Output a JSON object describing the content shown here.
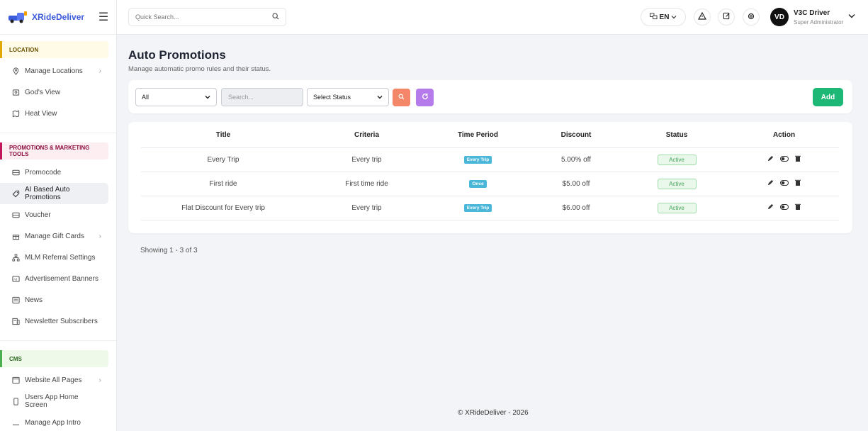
{
  "brand": {
    "name": "XRideDeliver"
  },
  "sidebar": {
    "sections": [
      {
        "title": "LOCATION",
        "items": [
          {
            "label": "Manage Locations",
            "icon": "location-pin-icon",
            "has_chevron": true
          },
          {
            "label": "God's View",
            "icon": "map-icon",
            "has_chevron": false
          },
          {
            "label": "Heat View",
            "icon": "heat-map-icon",
            "has_chevron": false
          }
        ]
      },
      {
        "title": "PROMOTIONS & MARKETING TOOLS",
        "items": [
          {
            "label": "Promocode",
            "icon": "ticket-icon",
            "has_chevron": false
          },
          {
            "label": "AI Based Auto Promotions",
            "icon": "tag-icon",
            "has_chevron": false,
            "active": true
          },
          {
            "label": "Voucher",
            "icon": "ticket-icon",
            "has_chevron": false
          },
          {
            "label": "Manage Gift Cards",
            "icon": "gift-icon",
            "has_chevron": true
          },
          {
            "label": "MLM Referral Settings",
            "icon": "hierarchy-icon",
            "has_chevron": false
          },
          {
            "label": "Advertisement Banners",
            "icon": "ad-icon",
            "has_chevron": false
          },
          {
            "label": "News",
            "icon": "news-icon",
            "has_chevron": false
          },
          {
            "label": "Newsletter Subscribers",
            "icon": "newsletter-icon",
            "has_chevron": false
          }
        ]
      },
      {
        "title": "CMS",
        "items": [
          {
            "label": "Website All Pages",
            "icon": "browser-icon",
            "has_chevron": true
          },
          {
            "label": "Users App Home Screen",
            "icon": "phone-icon",
            "has_chevron": false
          },
          {
            "label": "Manage App Intro",
            "icon": "intro-icon",
            "has_chevron": false
          }
        ]
      }
    ]
  },
  "topbar": {
    "search_placeholder": "Quick Search...",
    "language": "EN",
    "user_initials": "VD",
    "user_name": "V3C Driver",
    "user_role": "Super Administrator"
  },
  "page": {
    "title": "Auto Promotions",
    "subtitle": "Manage automatic promo rules and their status."
  },
  "filters": {
    "type_selected": "All",
    "search_placeholder": "Search...",
    "status_selected": "Select Status",
    "add_label": "Add"
  },
  "table": {
    "headers": [
      "Title",
      "Criteria",
      "Time Period",
      "Discount",
      "Status",
      "Action"
    ],
    "rows": [
      {
        "title": "Every Trip",
        "criteria": "Every trip",
        "time_period": "Every Trip",
        "discount": "5.00% off",
        "status": "Active"
      },
      {
        "title": "First ride",
        "criteria": "First time ride",
        "time_period": "Once",
        "discount": "$5.00 off",
        "status": "Active"
      },
      {
        "title": "Flat Discount for Every trip",
        "criteria": "Every trip",
        "time_period": "Every Trip",
        "discount": "$6.00 off",
        "status": "Active"
      }
    ]
  },
  "pagination": {
    "text": "Showing 1 - 3 of 3"
  },
  "footer": {
    "text": "© XRideDeliver - 2026"
  },
  "colors": {
    "accent_blue": "#3b5bdb",
    "add_green": "#1db876",
    "search_orange": "#f4876a",
    "refresh_purple": "#b57bea",
    "badge_blue": "#4ab7d8"
  }
}
